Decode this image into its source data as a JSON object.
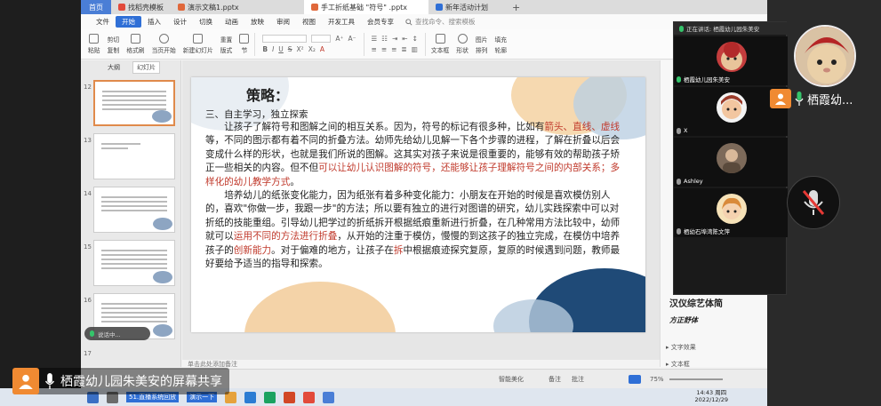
{
  "browser_tabs": {
    "home": "首页",
    "tab1": "找稻壳模板",
    "tab2": "演示文稿1.pptx",
    "tab3": "手工折纸基础 \"符号\" .pptx",
    "tab4": "新年活动计划"
  },
  "menubar": {
    "file": "文件",
    "start": "开始",
    "insert": "插入",
    "design": "设计",
    "transition": "切换",
    "animation": "动画",
    "slideshow": "放映",
    "review": "审阅",
    "view": "视图",
    "dev_tools": "开发工具",
    "member": "会员专享",
    "search_placeholder": "查找命令、搜索模板"
  },
  "ribbon": {
    "paste": "粘贴",
    "cut": "剪切",
    "copy": "复制",
    "format_painter": "格式刷",
    "from_current": "当页开始",
    "new_slide": "新建幻灯片",
    "layout": "版式",
    "section": "节",
    "reset": "重置",
    "textbox": "文本框",
    "shape": "形状",
    "arrange": "排列",
    "outline": "轮廓",
    "picture": "图片",
    "fill": "填充"
  },
  "thumb_panel": {
    "tab_outline": "大纲",
    "tab_slides": "幻灯片",
    "numbers": [
      "12",
      "13",
      "14",
      "15",
      "16",
      "17"
    ]
  },
  "slide": {
    "title": "策略：",
    "heading": "三、自主学习，独立探索",
    "p1_a": "让孩子了解符号和图解之间的相互关系。因为，符号的标记有很多种，比如有",
    "p1_hl1": "箭头、直线、虚线",
    "p1_b": "等，不同的图示都有着不同的折叠方法。幼师先给幼儿见解一下各个步骤的进程，了解在折叠以后会变成什么样的形状，也就是我们所说的图解。这其实对孩子来说是很重要的，能够有效的帮助孩子矫正一些相关的内容。但不但",
    "p1_hl2": "可以让幼儿认识图解的符号，还能够让孩子理解符号之间的内部关系；多样化的幼儿教学方式",
    "p1_c": "。",
    "p2_a": "培养幼儿的纸张变化能力，因为纸张有着多种变化能力：小朋友在开始的时候是喜欢模仿别人的，喜欢\"你做一步，我跟一步\"的方法；所以要有独立的进行对图谱的研究，幼儿实践探索中可以对折纸的技能重组。引导幼儿把学过的折纸拆开根据纸痕重新进行折叠，在几种常用方法比较中，幼师就可以",
    "p2_hl1": "运用不同的方法进行折叠",
    "p2_b": "，从开始的注重于模仿，慢慢的到这孩子的独立完成，在模仿中培养孩子的",
    "p2_hl2": "创新能力",
    "p2_c": "。对于偏难的地方，让孩子在",
    "p2_hl3": "拆",
    "p2_d": "中根据痕迹探究复原，复原的时候遇到问题，教师最好要给予适当的指导和探索。"
  },
  "notes_placeholder": "单击此处添加备注",
  "right_pane": {
    "font_sample": "汉仪综艺体简",
    "font_sample2": "方正舒体",
    "text_effect": "▸ 文字效果",
    "text_box": "▸ 文本框"
  },
  "statusbar": {
    "smart_beautify": "智能美化",
    "notes": "备注",
    "comments": "批注",
    "zoom": "75%"
  },
  "taskbar": {
    "item1": "51.直播系统回放",
    "item2": "腾讯会议",
    "item3": "演示一下",
    "time": "14:43 周四",
    "date": "2022/12/29"
  },
  "meeting": {
    "speaking_now": "正在讲话: 栖霞幼儿园朱美安",
    "participants": [
      {
        "name": "栖霞幼儿园朱美安"
      },
      {
        "name": "X"
      },
      {
        "name": "Ashley"
      },
      {
        "name": "栖幼石埠湾陈文萍"
      }
    ],
    "self_name": "栖霞幼...",
    "share_label": "栖霞幼儿园朱美安的屏幕共享",
    "recording_pill": "说话中..."
  },
  "colors": {
    "accent": "#2f6fd6",
    "highlight_red": "#c0392b",
    "user_orange": "#f08a32",
    "mic_green": "#35c46b"
  }
}
